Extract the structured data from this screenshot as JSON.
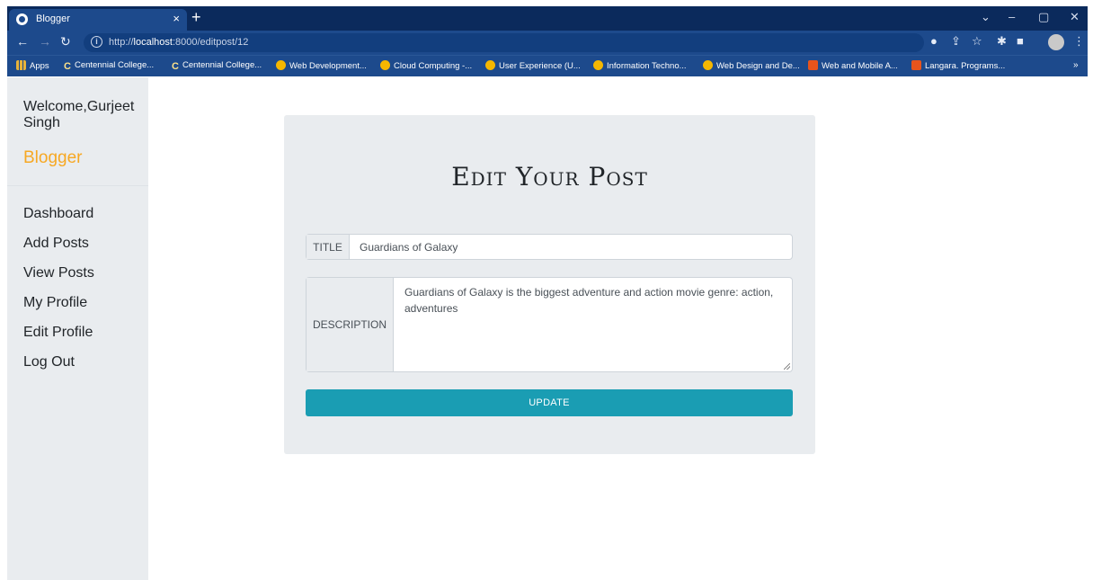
{
  "browser": {
    "tab_title": "Blogger",
    "tab_close": "×",
    "new_tab": "+",
    "url_scheme": "http://",
    "url_host": "localhost",
    "url_path": ":8000/editpost/12",
    "bookmarks": [
      {
        "label": "Apps",
        "icon": "apps-icon"
      },
      {
        "label": "Centennial College...",
        "icon": "centennial-icon"
      },
      {
        "label": "Centennial College...",
        "icon": "centennial-icon"
      },
      {
        "label": "Web Development...",
        "icon": "d2l-icon"
      },
      {
        "label": "Cloud Computing -...",
        "icon": "d2l-icon"
      },
      {
        "label": "User Experience (U...",
        "icon": "d2l-icon"
      },
      {
        "label": "Information Techno...",
        "icon": "d2l-icon"
      },
      {
        "label": "Web Design and De...",
        "icon": "d2l-icon"
      },
      {
        "label": "Web and Mobile A...",
        "icon": "langara-icon"
      },
      {
        "label": "Langara. Programs...",
        "icon": "langara-icon"
      }
    ],
    "more": "»"
  },
  "sidebar": {
    "welcome": "Welcome,Gurjeet Singh",
    "brand": "Blogger",
    "items": [
      "Dashboard",
      "Add Posts",
      "View Posts",
      "My Profile",
      "Edit Profile",
      "Log Out"
    ]
  },
  "form": {
    "heading": "Edit Your Post",
    "title_label": "TITLE",
    "title_value": "Guardians of Galaxy",
    "description_label": "DESCRIPTION",
    "description_value": "Guardians of Galaxy is the biggest adventure and action movie genre: action, adventures",
    "update_button": "UPDATE"
  },
  "colors": {
    "brand": "#f7a823",
    "button": "#1a9db3",
    "chrome": "#1d4a8c"
  }
}
